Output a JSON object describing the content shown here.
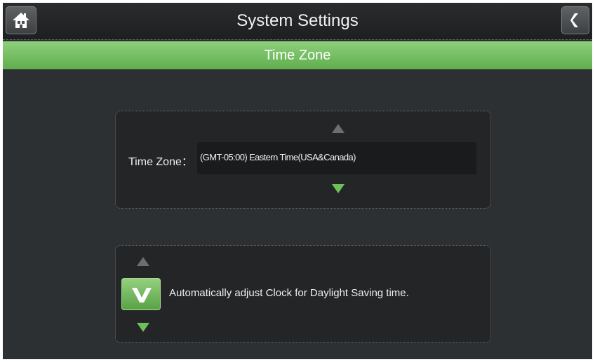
{
  "header": {
    "title": "System Settings",
    "home_icon": "home-icon",
    "back_icon": "chevron-left-icon"
  },
  "section": {
    "title": "Time Zone"
  },
  "time_zone": {
    "label": "Time Zone：",
    "value": "(GMT-05:00) Eastern  Time(USA&Canada)"
  },
  "daylight_saving": {
    "checked": true,
    "label": "Automatically adjust Clock for Daylight Saving time."
  },
  "colors": {
    "accent_green": "#6cbf58",
    "header_bg": "#1f2122",
    "panel_bg": "#232526",
    "screen_bg": "#2d3032"
  }
}
